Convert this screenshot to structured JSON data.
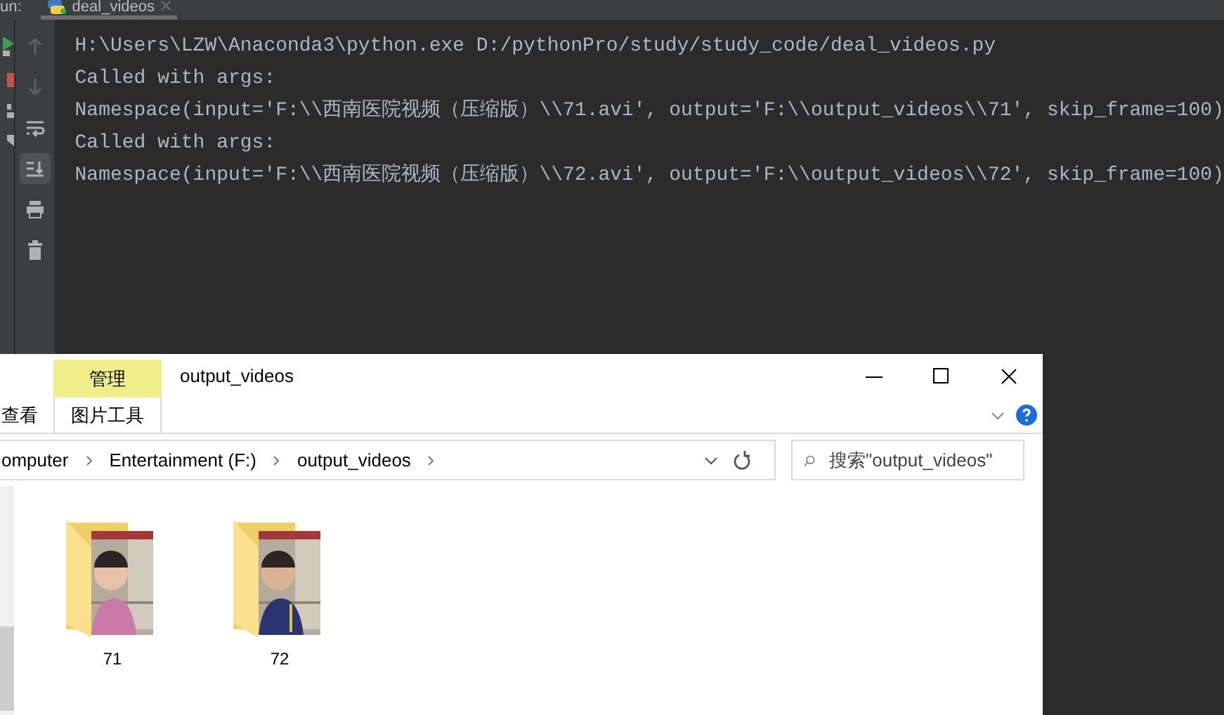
{
  "run_panel": {
    "label": "un:",
    "tab": {
      "title": "deal_videos"
    },
    "tools": [
      {
        "kind": "up",
        "disabled": true,
        "on": false
      },
      {
        "kind": "down",
        "disabled": true,
        "on": false
      },
      {
        "kind": "wrap",
        "disabled": false,
        "on": false
      },
      {
        "kind": "scroll-end",
        "disabled": false,
        "on": true
      },
      {
        "kind": "print",
        "disabled": false,
        "on": false
      },
      {
        "kind": "delete",
        "disabled": false,
        "on": false
      }
    ],
    "console_lines": [
      "H:\\Users\\LZW\\Anaconda3\\python.exe D:/pythonPro/study/study_code/deal_videos.py",
      "Called with args:",
      "Namespace(input='F:\\\\西南医院视频（压缩版）\\\\71.avi', output='F:\\\\output_videos\\\\71', skip_frame=100)",
      "Called with args:",
      "Namespace(input='F:\\\\西南医院视频（压缩版）\\\\72.avi', output='F:\\\\output_videos\\\\72', skip_frame=100)"
    ]
  },
  "explorer": {
    "context_tab": {
      "header": "管理",
      "label": "图片工具"
    },
    "title": "output_videos",
    "ribbon_tabs": [
      "查看"
    ],
    "breadcrumbs": [
      "omputer",
      "Entertainment (F:)",
      "output_videos"
    ],
    "search": {
      "placeholder": "搜索\"output_videos\""
    },
    "items": [
      {
        "name": "71",
        "kind": "picture"
      },
      {
        "name": "72",
        "kind": "picture"
      }
    ]
  }
}
